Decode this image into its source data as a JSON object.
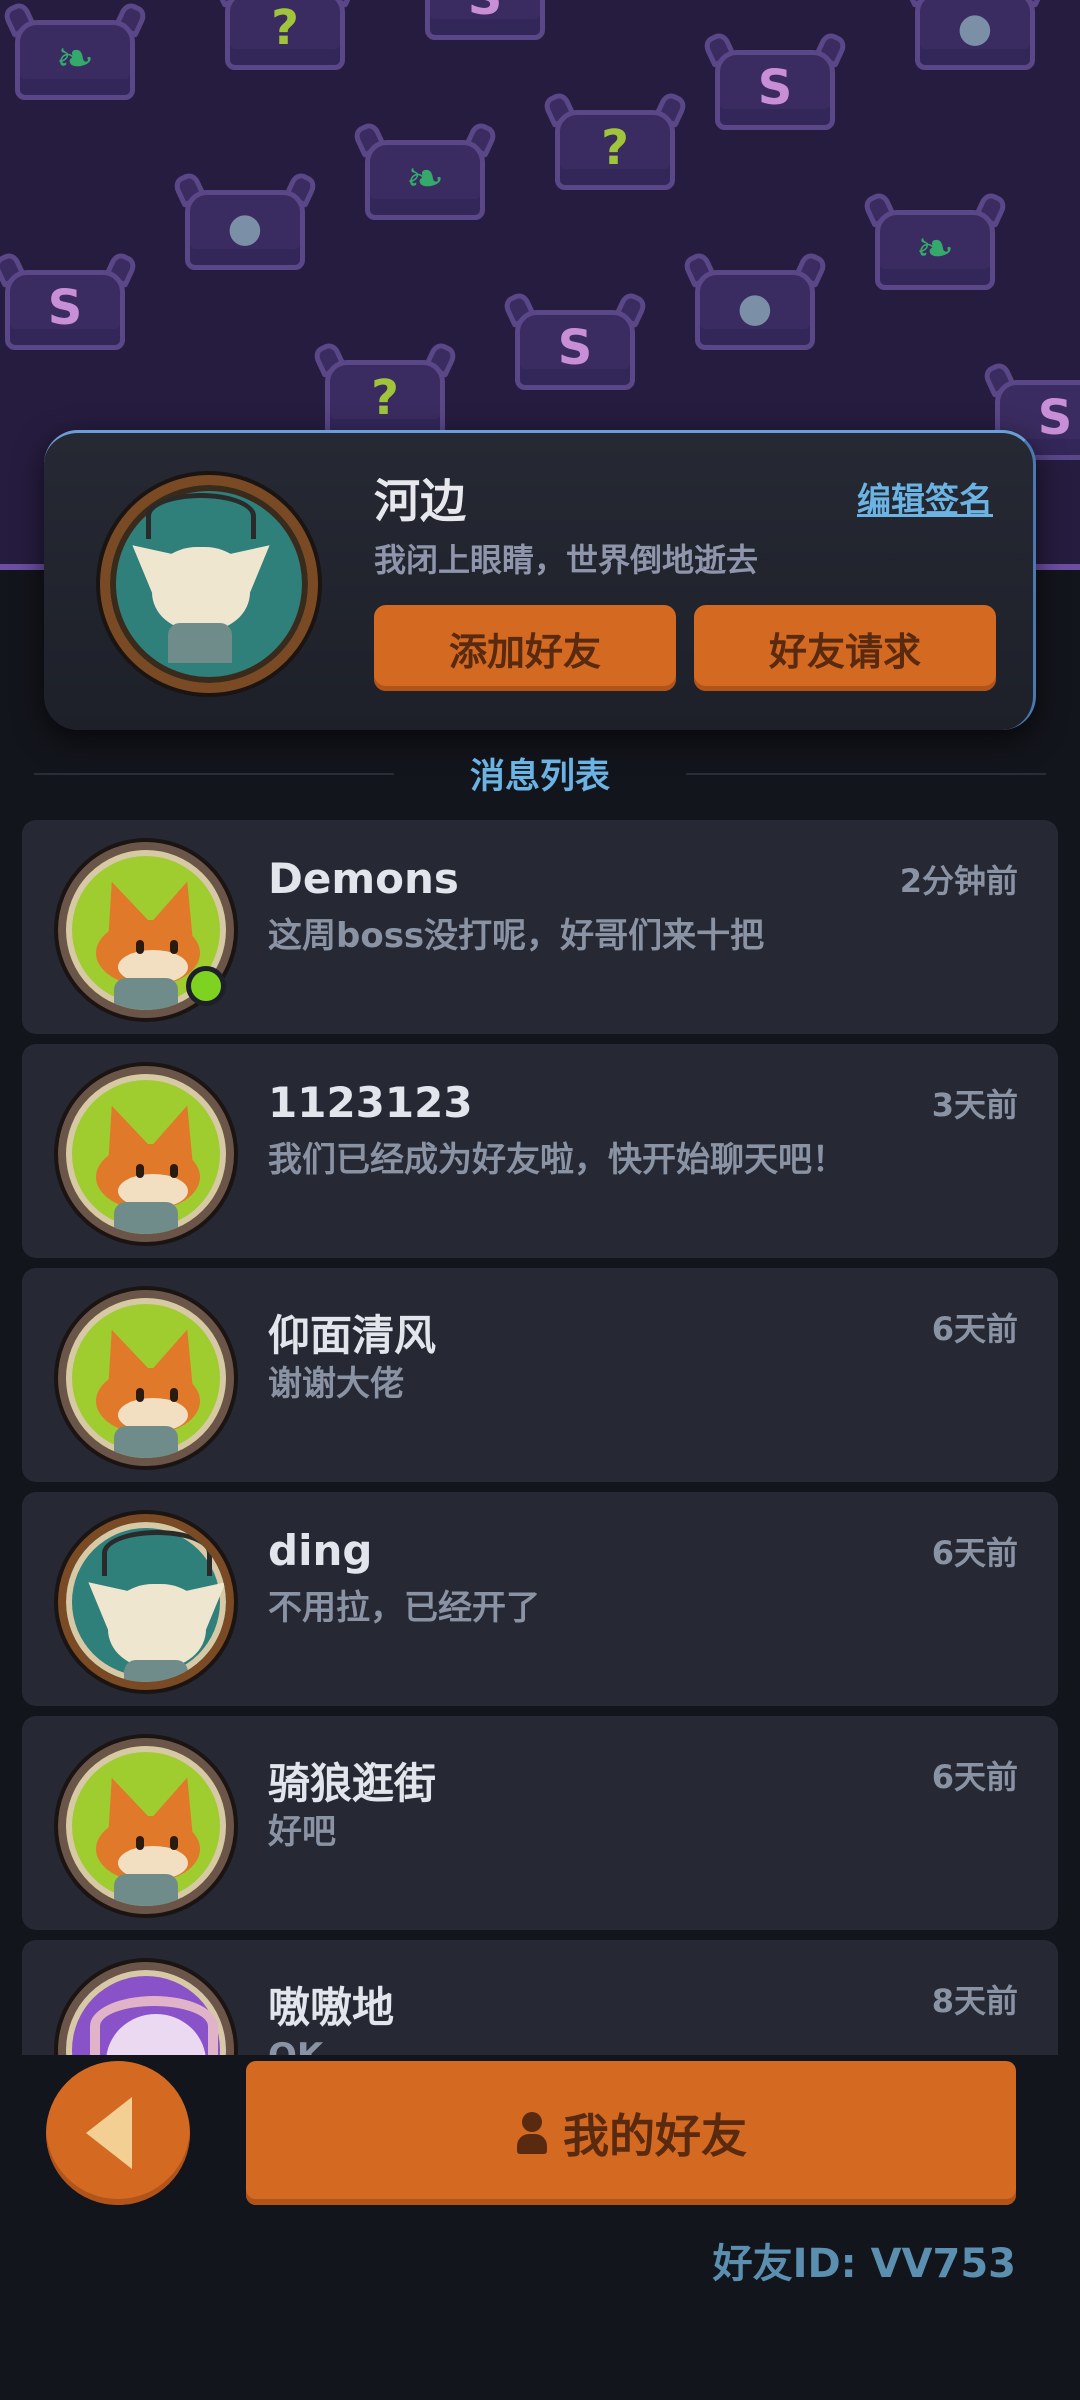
{
  "profile": {
    "name": "河边",
    "signature": "我闭上眼睛，世界倒地逝去",
    "edit_signature_label": "编辑签名",
    "add_friend_label": "添加好友",
    "friend_requests_label": "好友请求"
  },
  "section": {
    "title": "消息列表"
  },
  "messages": [
    {
      "name": "Demons",
      "text": "这周boss没打呢，好哥们来十把",
      "time": "2分钟前",
      "avatar": "fox-icon",
      "online": true
    },
    {
      "name": "1123123",
      "text": "我们已经成为好友啦，快开始聊天吧！",
      "time": "3天前",
      "avatar": "fox-icon"
    },
    {
      "name": "仰面清风",
      "text": "谢谢大佬",
      "time": "6天前",
      "avatar": "fox-icon"
    },
    {
      "name": "ding",
      "text": "不用拉，已经开了",
      "time": "6天前",
      "avatar": "antler-cat-icon"
    },
    {
      "name": "骑狼逛街",
      "text": "好吧",
      "time": "6天前",
      "avatar": "fox-icon"
    },
    {
      "name": "嗷嗷地",
      "text": "OK",
      "time": "8天前",
      "avatar": "horned-goat-icon"
    }
  ],
  "bottom": {
    "my_friends_label": "我的好友",
    "friend_id": "好友ID: VV753"
  },
  "colors": {
    "accent_orange": "#d46a22",
    "link_blue": "#6ab3e3",
    "online_green": "#7ed321",
    "banner_purple": "#261c3f"
  }
}
